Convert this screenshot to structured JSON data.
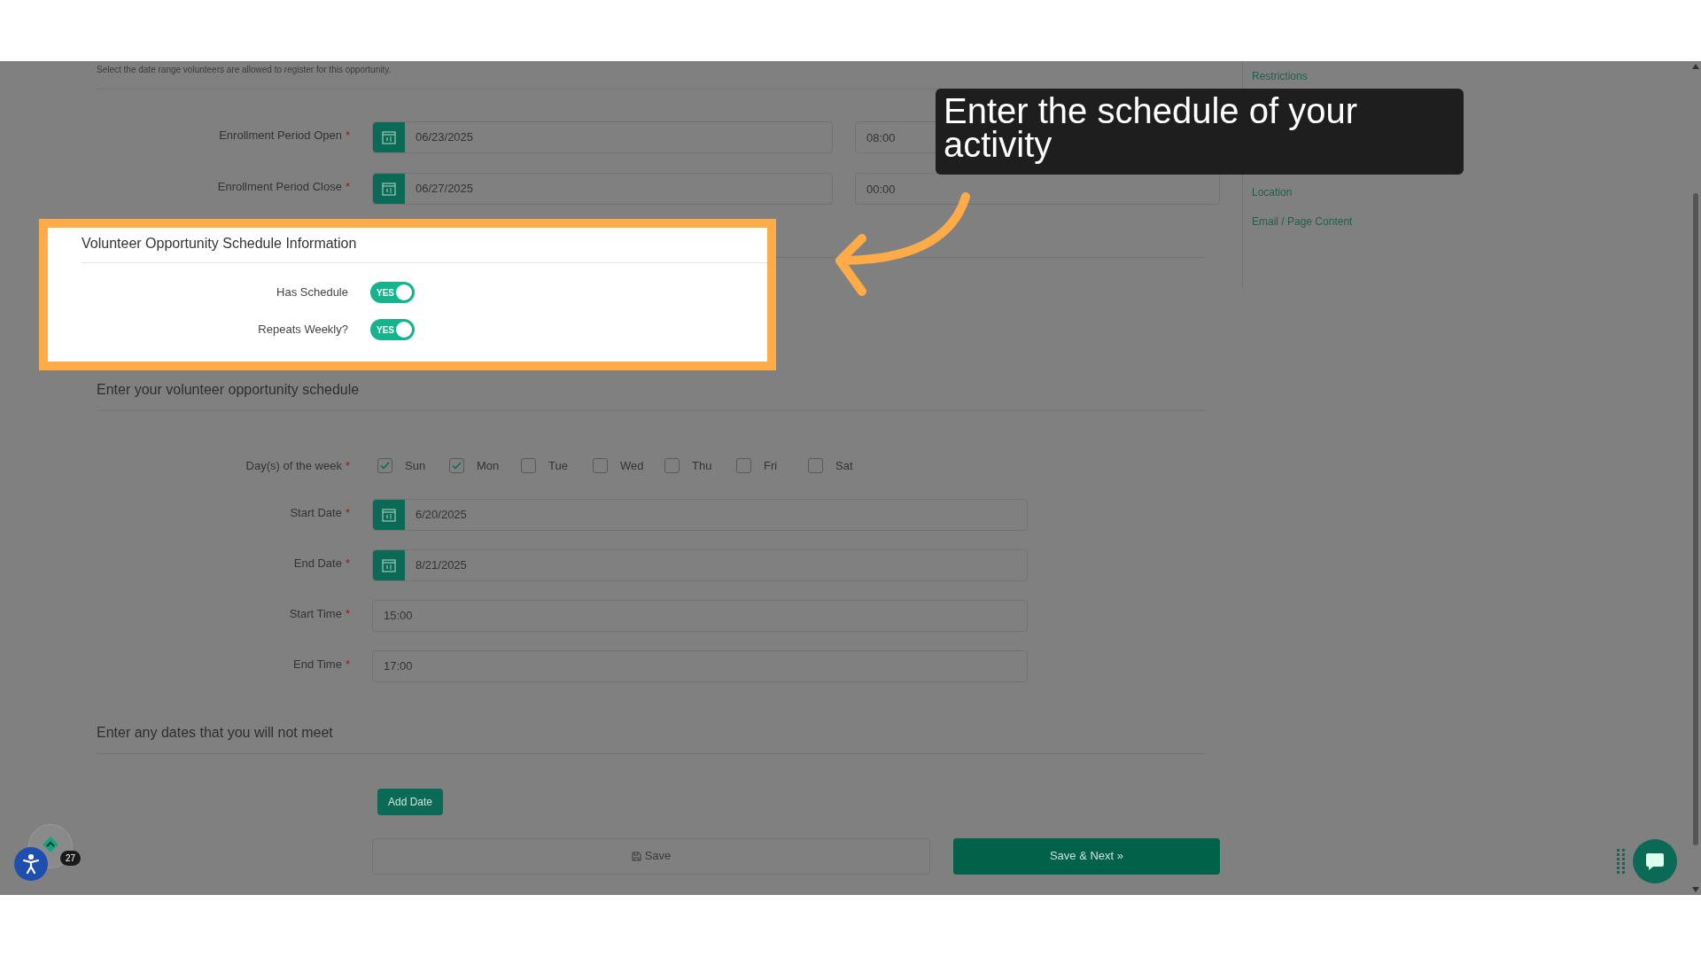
{
  "header_note": "Select the date range volunteers are allowed to register for this opportunity.",
  "enrollment": [
    {
      "label": "Enrollment Period Open",
      "required_mark": "*",
      "date": "06/23/2025",
      "time": "08:00"
    },
    {
      "label": "Enrollment Period Close",
      "required_mark": "*",
      "date": "06/27/2025",
      "time": "00:00"
    }
  ],
  "schedule_info": {
    "title": "Volunteer Opportunity Schedule Information",
    "toggles": [
      {
        "label": "Has Schedule",
        "on": true,
        "text": "YES"
      },
      {
        "label": "Repeats Weekly?",
        "on": true,
        "text": "YES"
      }
    ]
  },
  "schedule": {
    "title": "Enter your volunteer opportunity schedule",
    "days_label": "Day(s) of the week",
    "days_required_mark": "*",
    "days": [
      {
        "label": "Sun",
        "checked": true
      },
      {
        "label": "Mon",
        "checked": true
      },
      {
        "label": "Tue",
        "checked": false
      },
      {
        "label": "Wed",
        "checked": false
      },
      {
        "label": "Thu",
        "checked": false
      },
      {
        "label": "Fri",
        "checked": false
      },
      {
        "label": "Sat",
        "checked": false
      }
    ],
    "fields": [
      {
        "kind": "date",
        "label": "Start Date",
        "required_mark": "*",
        "value": "6/20/2025"
      },
      {
        "kind": "date",
        "label": "End Date",
        "required_mark": "*",
        "value": "8/21/2025"
      },
      {
        "kind": "time",
        "label": "Start Time",
        "required_mark": "*",
        "value": "15:00"
      },
      {
        "kind": "time",
        "label": "End Time",
        "required_mark": "*",
        "value": "17:00"
      }
    ]
  },
  "exceptions": {
    "title": "Enter any dates that you will not meet",
    "button": "Add Date"
  },
  "actions": {
    "save": "Save",
    "save_next": "Save & Next »"
  },
  "sidebar": {
    "items": [
      {
        "label": "Restrictions"
      },
      {
        "label": "Location"
      },
      {
        "label": "Email / Page Content"
      }
    ]
  },
  "callout": {
    "text": "Enter the schedule of your activity"
  },
  "badge": {
    "count": "27"
  }
}
